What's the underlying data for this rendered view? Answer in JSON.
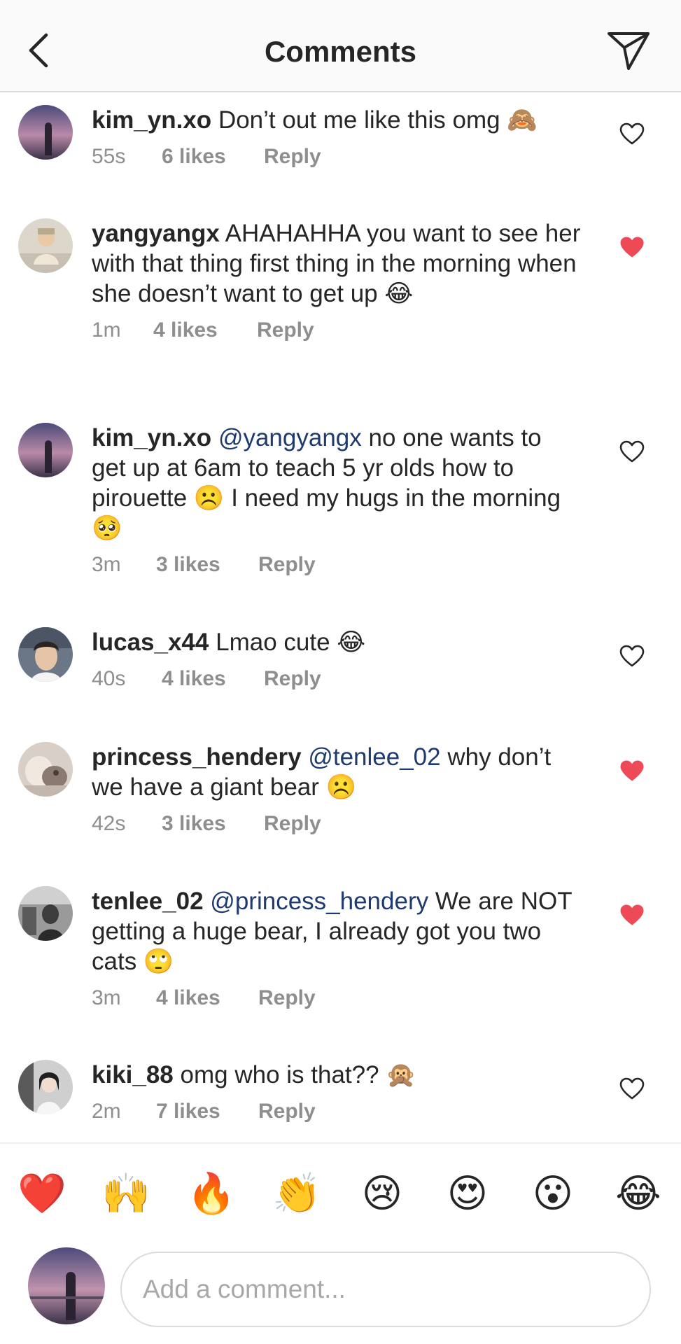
{
  "header": {
    "title": "Comments"
  },
  "comments": [
    {
      "user": "kim_yn.xo",
      "mention": "",
      "text": "Don’t out me like this omg 🙈",
      "time": "55s",
      "likes": "6 likes",
      "reply": "Reply",
      "liked": false
    },
    {
      "user": "yangyangx",
      "mention": "",
      "text": "AHAHAHHA you want to see her with that thing first thing in the morning when she doesn’t want to get up 😂",
      "time": "1m",
      "likes": "4 likes",
      "reply": "Reply",
      "liked": true
    },
    {
      "user": "kim_yn.xo",
      "mention": "@yangyangx",
      "text": "no one wants to get up at 6am to teach 5 yr olds how to pirouette ☹️ I need my hugs in the morning 🥺",
      "time": "3m",
      "likes": "3 likes",
      "reply": "Reply",
      "liked": false
    },
    {
      "user": "lucas_x44",
      "mention": "",
      "text": "Lmao cute 😂",
      "time": "40s",
      "likes": "4 likes",
      "reply": "Reply",
      "liked": false
    },
    {
      "user": "princess_hendery",
      "mention": "@tenlee_02",
      "text": "why don’t we have a giant bear ☹️",
      "time": "42s",
      "likes": "3 likes",
      "reply": "Reply",
      "liked": true
    },
    {
      "user": "tenlee_02",
      "mention": "@princess_hendery",
      "text": "We are NOT getting a huge bear, I already got you two cats 🙄",
      "time": "3m",
      "likes": "4 likes",
      "reply": "Reply",
      "liked": true
    },
    {
      "user": "kiki_88",
      "mention": "",
      "text": "omg who is that?? 🙊",
      "time": "2m",
      "likes": "7 likes",
      "reply": "Reply",
      "liked": false
    }
  ],
  "emoji_bar": [
    "❤️",
    "🙌",
    "🔥",
    "👏",
    "😢",
    "😍",
    "😮",
    "😂"
  ],
  "input": {
    "placeholder": "Add a comment..."
  },
  "colors": {
    "liked_heart": "#ed4956",
    "mention": "#1e3a6e",
    "meta": "#8e8e8e"
  }
}
